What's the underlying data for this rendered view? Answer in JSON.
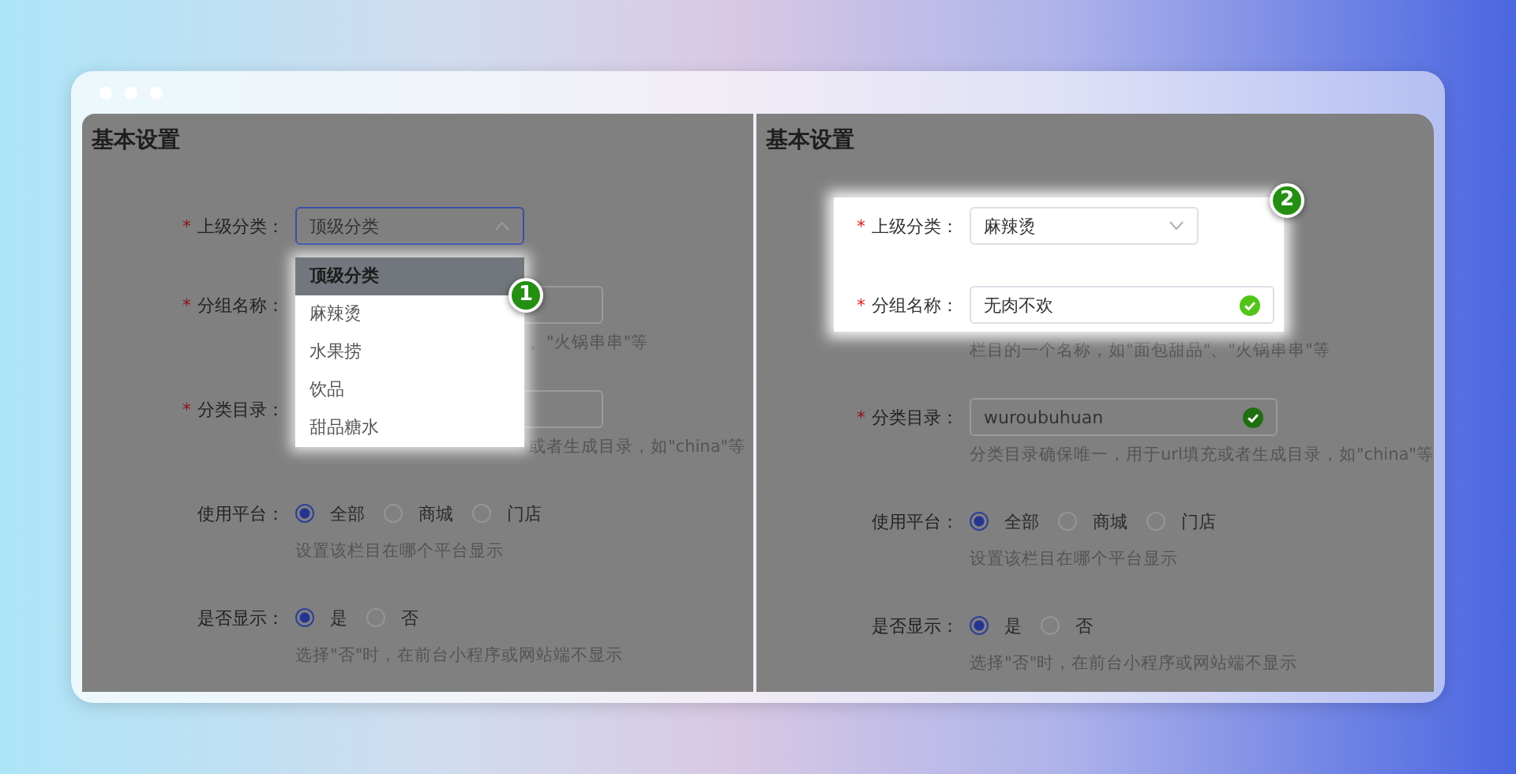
{
  "panels": [
    {
      "heading": "基本设置",
      "kind": "menu",
      "badge": "1",
      "fields": [
        {
          "kind": "select",
          "label": "上级分类：",
          "required_mark": "*",
          "value": "顶级分类",
          "open": true,
          "options": [
            {
              "label": "顶级分类",
              "selected": true
            },
            {
              "label": "麻辣烫",
              "selected": false
            },
            {
              "label": "水果捞",
              "selected": false
            },
            {
              "label": "饮品",
              "selected": false
            },
            {
              "label": "甜品糖水",
              "selected": false
            }
          ]
        },
        {
          "kind": "text",
          "label": "分组名称：",
          "required_mark": "*",
          "valid": false,
          "hint": "、\"火锅串串\"等"
        },
        {
          "kind": "text",
          "label": "分类目录：",
          "required_mark": "*",
          "valid": false,
          "hint": "或者生成目录，如\"china\"等"
        },
        {
          "kind": "radio",
          "label": "使用平台：",
          "hint": "设置该栏目在哪个平台显示",
          "options": [
            {
              "label": "全部",
              "selected": true
            },
            {
              "label": "商城",
              "selected": false
            },
            {
              "label": "门店",
              "selected": false
            }
          ]
        },
        {
          "kind": "radio",
          "label": "是否显示：",
          "hint": "选择\"否\"时，在前台小程序或网站端不显示",
          "options": [
            {
              "label": "是",
              "selected": true
            },
            {
              "label": "否",
              "selected": false
            }
          ]
        }
      ]
    },
    {
      "heading": "基本设置",
      "kind": "fields",
      "badge": "2",
      "fields": [
        {
          "kind": "select",
          "label": "上级分类：",
          "required_mark": "*",
          "value": "麻辣烫",
          "open": false
        },
        {
          "kind": "text",
          "label": "分组名称：",
          "required_mark": "*",
          "value": "无肉不欢",
          "valid": true,
          "hint": "栏目的一个名称，如\"面包甜品\"、\"火锅串串\"等"
        },
        {
          "kind": "text",
          "label": "分类目录：",
          "required_mark": "*",
          "value": "wuroubuhuan",
          "valid": true,
          "hint": "分类目录确保唯一，用于url填充或者生成目录，如\"china\"等"
        },
        {
          "kind": "radio",
          "label": "使用平台：",
          "hint": "设置该栏目在哪个平台显示",
          "options": [
            {
              "label": "全部",
              "selected": true
            },
            {
              "label": "商城",
              "selected": false
            },
            {
              "label": "门店",
              "selected": false
            }
          ]
        },
        {
          "kind": "radio",
          "label": "是否显示：",
          "hint": "选择\"否\"时，在前台小程序或网站端不显示",
          "options": [
            {
              "label": "是",
              "selected": true
            },
            {
              "label": "否",
              "selected": false
            }
          ]
        }
      ]
    }
  ]
}
